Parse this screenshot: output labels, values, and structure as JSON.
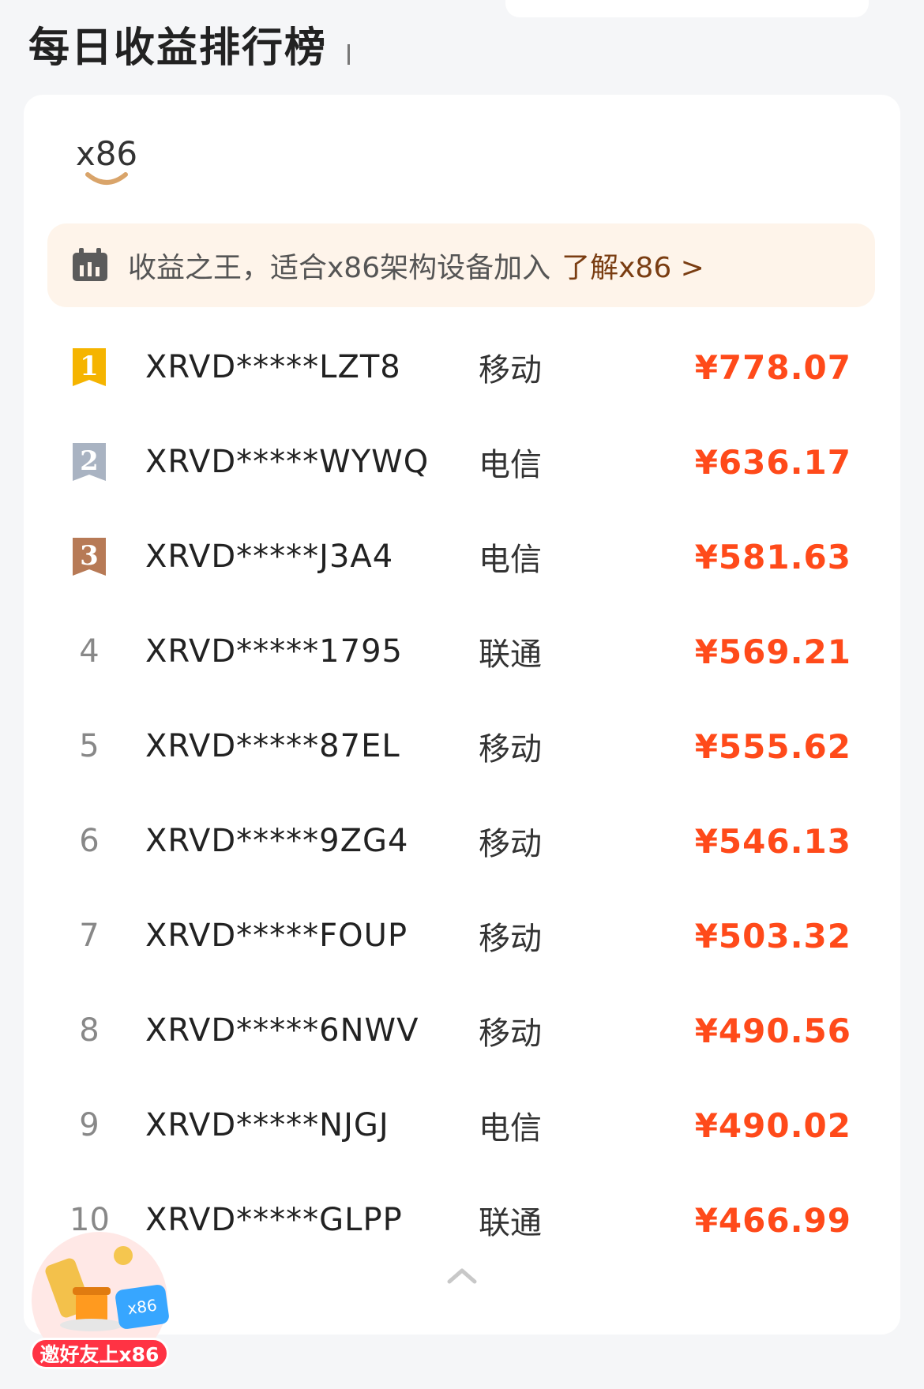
{
  "page": {
    "title": "每日收益排行榜"
  },
  "tab": {
    "label": "x86"
  },
  "banner": {
    "text": "收益之王，适合x86架构设备加入",
    "link": "了解x86 >"
  },
  "colors": {
    "amount": "#ff4a1a",
    "gold": "#f5b400",
    "silver": "#a9b3c2",
    "bronze": "#b77a56",
    "banner_bg": "#fef4ea"
  },
  "leaderboard": [
    {
      "rank": "1",
      "device": "XRVD*****LZT8",
      "isp": "移动",
      "amount": "¥778.07"
    },
    {
      "rank": "2",
      "device": "XRVD*****WYWQ",
      "isp": "电信",
      "amount": "¥636.17"
    },
    {
      "rank": "3",
      "device": "XRVD*****J3A4",
      "isp": "电信",
      "amount": "¥581.63"
    },
    {
      "rank": "4",
      "device": "XRVD*****1795",
      "isp": "联通",
      "amount": "¥569.21"
    },
    {
      "rank": "5",
      "device": "XRVD*****87EL",
      "isp": "移动",
      "amount": "¥555.62"
    },
    {
      "rank": "6",
      "device": "XRVD*****9ZG4",
      "isp": "移动",
      "amount": "¥546.13"
    },
    {
      "rank": "7",
      "device": "XRVD*****FOUP",
      "isp": "移动",
      "amount": "¥503.32"
    },
    {
      "rank": "8",
      "device": "XRVD*****6NWV",
      "isp": "移动",
      "amount": "¥490.56"
    },
    {
      "rank": "9",
      "device": "XRVD*****NJGJ",
      "isp": "电信",
      "amount": "¥490.02"
    },
    {
      "rank": "10",
      "device": "XRVD*****GLPP",
      "isp": "联通",
      "amount": "¥466.99"
    }
  ],
  "promo": {
    "label": "邀好友上x86",
    "badge": "x86"
  }
}
